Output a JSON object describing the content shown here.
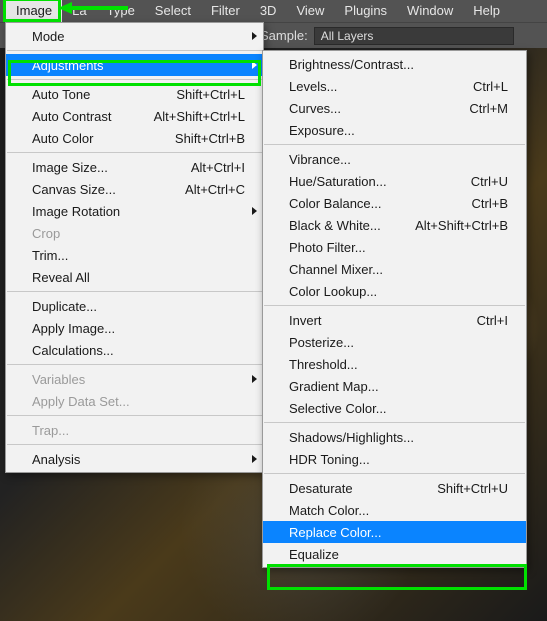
{
  "menubar": [
    "Image",
    "La",
    "Type",
    "Select",
    "Filter",
    "3D",
    "View",
    "Plugins",
    "Window",
    "Help"
  ],
  "menubar_open_index": 0,
  "toolbar": {
    "sample_label": "Sample:",
    "sample_value": "All Layers"
  },
  "primary_menu": [
    {
      "t": "item",
      "label": "Mode",
      "sub": true
    },
    {
      "t": "sep"
    },
    {
      "t": "item",
      "label": "Adjustments",
      "sub": true,
      "hl": true
    },
    {
      "t": "sep"
    },
    {
      "t": "item",
      "label": "Auto Tone",
      "shortcut": "Shift+Ctrl+L"
    },
    {
      "t": "item",
      "label": "Auto Contrast",
      "shortcut": "Alt+Shift+Ctrl+L"
    },
    {
      "t": "item",
      "label": "Auto Color",
      "shortcut": "Shift+Ctrl+B"
    },
    {
      "t": "sep"
    },
    {
      "t": "item",
      "label": "Image Size...",
      "shortcut": "Alt+Ctrl+I"
    },
    {
      "t": "item",
      "label": "Canvas Size...",
      "shortcut": "Alt+Ctrl+C"
    },
    {
      "t": "item",
      "label": "Image Rotation",
      "sub": true
    },
    {
      "t": "item",
      "label": "Crop",
      "disabled": true
    },
    {
      "t": "item",
      "label": "Trim..."
    },
    {
      "t": "item",
      "label": "Reveal All"
    },
    {
      "t": "sep"
    },
    {
      "t": "item",
      "label": "Duplicate..."
    },
    {
      "t": "item",
      "label": "Apply Image..."
    },
    {
      "t": "item",
      "label": "Calculations..."
    },
    {
      "t": "sep"
    },
    {
      "t": "item",
      "label": "Variables",
      "sub": true,
      "disabled": true
    },
    {
      "t": "item",
      "label": "Apply Data Set...",
      "disabled": true
    },
    {
      "t": "sep"
    },
    {
      "t": "item",
      "label": "Trap...",
      "disabled": true
    },
    {
      "t": "sep"
    },
    {
      "t": "item",
      "label": "Analysis",
      "sub": true
    }
  ],
  "secondary_menu": [
    {
      "t": "item",
      "label": "Brightness/Contrast..."
    },
    {
      "t": "item",
      "label": "Levels...",
      "shortcut": "Ctrl+L"
    },
    {
      "t": "item",
      "label": "Curves...",
      "shortcut": "Ctrl+M"
    },
    {
      "t": "item",
      "label": "Exposure..."
    },
    {
      "t": "sep"
    },
    {
      "t": "item",
      "label": "Vibrance..."
    },
    {
      "t": "item",
      "label": "Hue/Saturation...",
      "shortcut": "Ctrl+U"
    },
    {
      "t": "item",
      "label": "Color Balance...",
      "shortcut": "Ctrl+B"
    },
    {
      "t": "item",
      "label": "Black & White...",
      "shortcut": "Alt+Shift+Ctrl+B"
    },
    {
      "t": "item",
      "label": "Photo Filter..."
    },
    {
      "t": "item",
      "label": "Channel Mixer..."
    },
    {
      "t": "item",
      "label": "Color Lookup..."
    },
    {
      "t": "sep"
    },
    {
      "t": "item",
      "label": "Invert",
      "shortcut": "Ctrl+I"
    },
    {
      "t": "item",
      "label": "Posterize..."
    },
    {
      "t": "item",
      "label": "Threshold..."
    },
    {
      "t": "item",
      "label": "Gradient Map..."
    },
    {
      "t": "item",
      "label": "Selective Color..."
    },
    {
      "t": "sep"
    },
    {
      "t": "item",
      "label": "Shadows/Highlights..."
    },
    {
      "t": "item",
      "label": "HDR Toning..."
    },
    {
      "t": "sep"
    },
    {
      "t": "item",
      "label": "Desaturate",
      "shortcut": "Shift+Ctrl+U"
    },
    {
      "t": "item",
      "label": "Match Color..."
    },
    {
      "t": "item",
      "label": "Replace Color...",
      "hl": true
    },
    {
      "t": "item",
      "label": "Equalize"
    }
  ]
}
